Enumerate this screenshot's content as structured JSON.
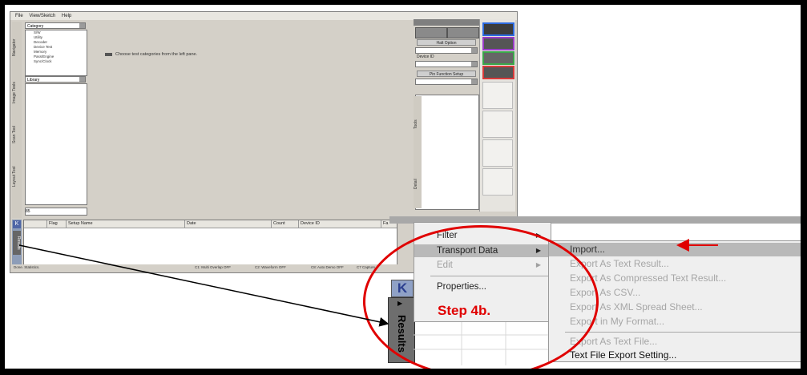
{
  "menubar": {
    "items": [
      "File",
      "View/Sketch",
      "Help"
    ]
  },
  "side_tabs": [
    "Navigator",
    "Image Tools",
    "Scan Tool",
    "Layout Tool"
  ],
  "category_panel": {
    "category_label": "Category",
    "categories": [
      "S/W",
      "Utility",
      "Decoder",
      "Device Test",
      "Memory",
      "Pass/Engine",
      "Sync/Clock"
    ],
    "library_label": "Library",
    "footer_value": "85"
  },
  "workarea": {
    "hint": "Choose test categories from the left pane."
  },
  "result_grid": {
    "columns": [
      "Flag",
      "Setup Name",
      "Date",
      "Count",
      "Device ID",
      "Fa"
    ]
  },
  "statusbar": {
    "left": "Done. Statistics.",
    "items": [
      "C1: Multi Overlap OFF",
      "C2: Waveform OFF",
      "C8: Auto Demo OFF",
      "C7 Capture"
    ]
  },
  "left_results_tab": {
    "label": "Results"
  },
  "right_panel": {
    "connect_label": "Halt Option",
    "device_label": "Device ID",
    "register_label": "Pin Function Setup",
    "tab1": "Tools",
    "tab2": "Detail"
  },
  "context_menu": [
    {
      "label": "Filter",
      "submenu": true,
      "enabled": true
    },
    {
      "label": "Transport Data",
      "submenu": true,
      "enabled": true,
      "highlighted": true
    },
    {
      "label": "Edit",
      "submenu": true,
      "enabled": false
    },
    {
      "label": "Properties...",
      "submenu": false,
      "enabled": true
    }
  ],
  "submenu": [
    {
      "label": "Import...",
      "enabled": true,
      "highlighted": true
    },
    {
      "label": "Export As Text Result...",
      "enabled": false
    },
    {
      "label": "Export As Compressed Text Result...",
      "enabled": false
    },
    {
      "label": "Export As CSV...",
      "enabled": false
    },
    {
      "label": "Export As XML Spread Sheet...",
      "enabled": false
    },
    {
      "label": "Export in My Format...",
      "enabled": false
    },
    {
      "label": "Export As Text File...",
      "enabled": false
    },
    {
      "label": "Text File Export Setting...",
      "enabled": true
    }
  ],
  "results_tab": {
    "label": "Results",
    "k_label": "K"
  },
  "annotation": {
    "step_label": "Step 4b.",
    "color": "#e00000"
  }
}
